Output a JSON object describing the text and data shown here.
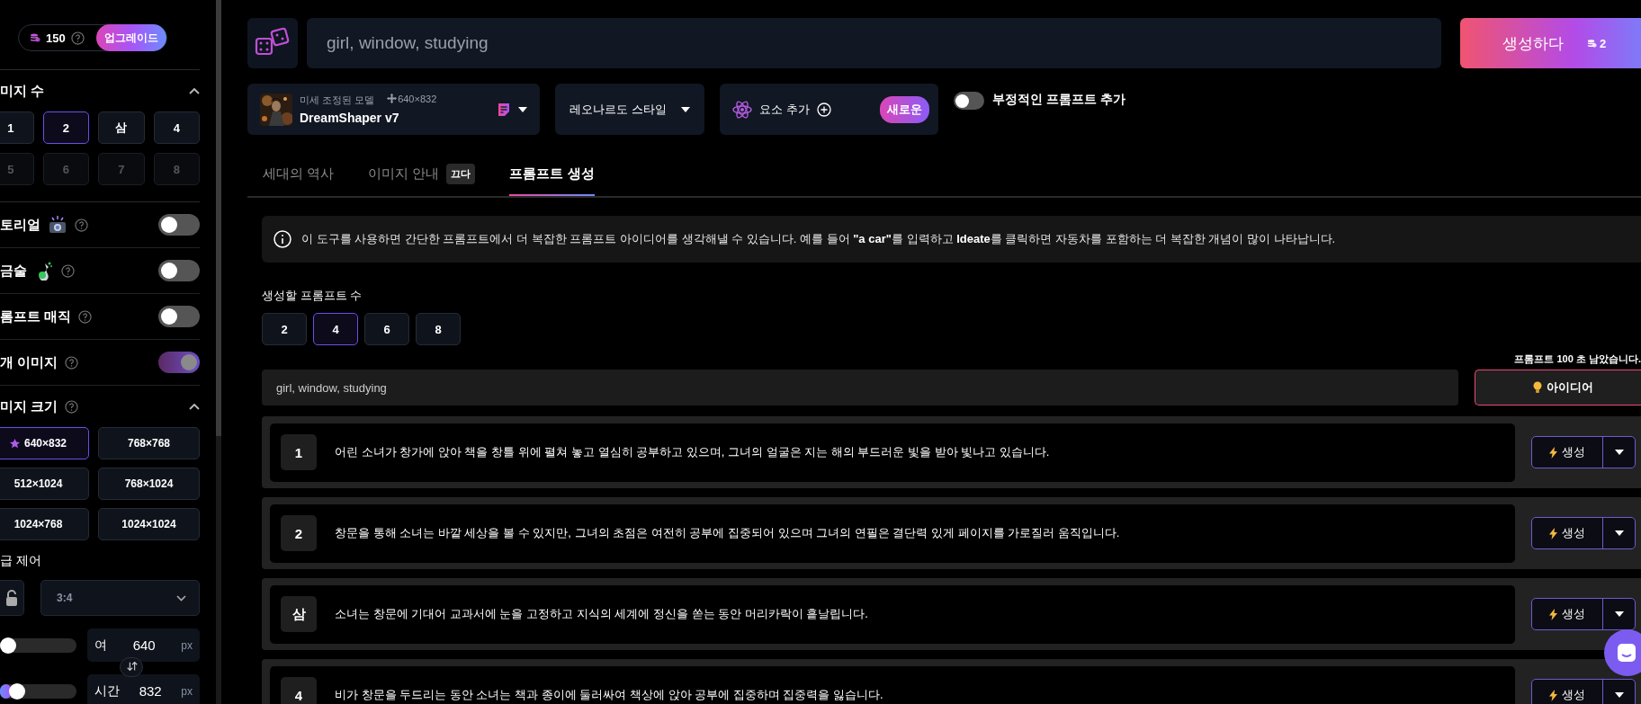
{
  "sidebar": {
    "credits": "150",
    "upgrade_button": "업그레이드",
    "image_count": {
      "title": "미지 수",
      "expanded": true,
      "options": [
        {
          "label": "1",
          "selected": false,
          "disabled": false
        },
        {
          "label": "2",
          "selected": true,
          "disabled": false
        },
        {
          "label": "삼",
          "selected": false,
          "disabled": false
        },
        {
          "label": "4",
          "selected": false,
          "disabled": false
        },
        {
          "label": "5",
          "selected": false,
          "disabled": true
        },
        {
          "label": "6",
          "selected": false,
          "disabled": true
        },
        {
          "label": "7",
          "selected": false,
          "disabled": true
        },
        {
          "label": "8",
          "selected": false,
          "disabled": true
        }
      ]
    },
    "toggles": [
      {
        "label": "토리얼",
        "on": false
      },
      {
        "label": "금술",
        "on": false
      },
      {
        "label": "롬프트 매직",
        "on": false
      },
      {
        "label": "개 이미지",
        "on": true
      }
    ],
    "image_size": {
      "title": "미지 크기",
      "expanded": true,
      "options": [
        {
          "label": "640×832",
          "selected": true
        },
        {
          "label": "768×768",
          "selected": false
        },
        {
          "label": "512×1024",
          "selected": false
        },
        {
          "label": "768×1024",
          "selected": false
        },
        {
          "label": "1024×768",
          "selected": false
        },
        {
          "label": "1024×1024",
          "selected": false
        }
      ]
    },
    "advanced": {
      "title": "급 제어",
      "aspect_ratio": "3:4",
      "width": {
        "label": "여",
        "value": "640",
        "unit": "px",
        "level": 0.0
      },
      "height": {
        "label": "시간",
        "value": "832",
        "unit": "px",
        "level": 0.15
      }
    }
  },
  "prompt": {
    "value": "girl, window, studying"
  },
  "generate_button": {
    "label": "생성하다",
    "cost": "2"
  },
  "model": {
    "caption": "미세 조정된 모델",
    "size": "640×832",
    "name": "DreamShaper v7"
  },
  "style_dropdown": "레오나르도 스타일",
  "elements": {
    "label": "요소 추가",
    "badge": "새로운"
  },
  "negative_prompt": {
    "label": "부정적인 프롬프트 추가",
    "on": false
  },
  "tabs": [
    {
      "label": "세대의 역사",
      "selected": false
    },
    {
      "label": "이미지 안내",
      "badge": "끄다",
      "selected": false
    },
    {
      "label": "프롬프트 생성",
      "selected": true
    }
  ],
  "info": "이 도구를 사용하면 간단한 프롬프트에서 더 복잡한 프롬프트 아이디어를 생각해낼 수 있습니다. 예를 들어 **\"a car\"**를 입력하고 **Ideate**를 클릭하면 자동차를 포함하는 더 복잡한 개념이 많이 나타납니다.",
  "prompt_count": {
    "label": "생성할 프롬프트 수",
    "options": [
      {
        "label": "2",
        "selected": false
      },
      {
        "label": "4",
        "selected": true
      },
      {
        "label": "6",
        "selected": false
      },
      {
        "label": "8",
        "selected": false
      }
    ]
  },
  "remaining": "프롬프트 100 초 남았습니다.",
  "idea_input": {
    "value": "girl, window, studying"
  },
  "ideate_button": "아이디어",
  "prompts": [
    {
      "number": "1",
      "text": "어린 소녀가 창가에 앉아 책을 창틀 위에 펼쳐 놓고 열심히 공부하고 있으며, 그녀의 얼굴은 지는 해의 부드러운 빛을 받아 빛나고 있습니다.",
      "button": "생성"
    },
    {
      "number": "2",
      "text": "창문을 통해 소녀는 바깥 세상을 볼 수 있지만, 그녀의 초점은 여전히 공부에 집중되어 있으며 그녀의 연필은 결단력 있게 페이지를 가로질러 움직입니다.",
      "button": "생성"
    },
    {
      "number": "삼",
      "text": "소녀는 창문에 기대어 교과서에 눈을 고정하고 지식의 세계에 정신을 쏟는 동안 머리카락이 흩날립니다.",
      "button": "생성"
    },
    {
      "number": "4",
      "text": "비가 창문을 두드리는 동안 소녀는 책과 종이에 둘러싸여 책상에 앉아 공부에 집중하며 집중력을 잃습니다.",
      "button": "생성"
    }
  ]
}
